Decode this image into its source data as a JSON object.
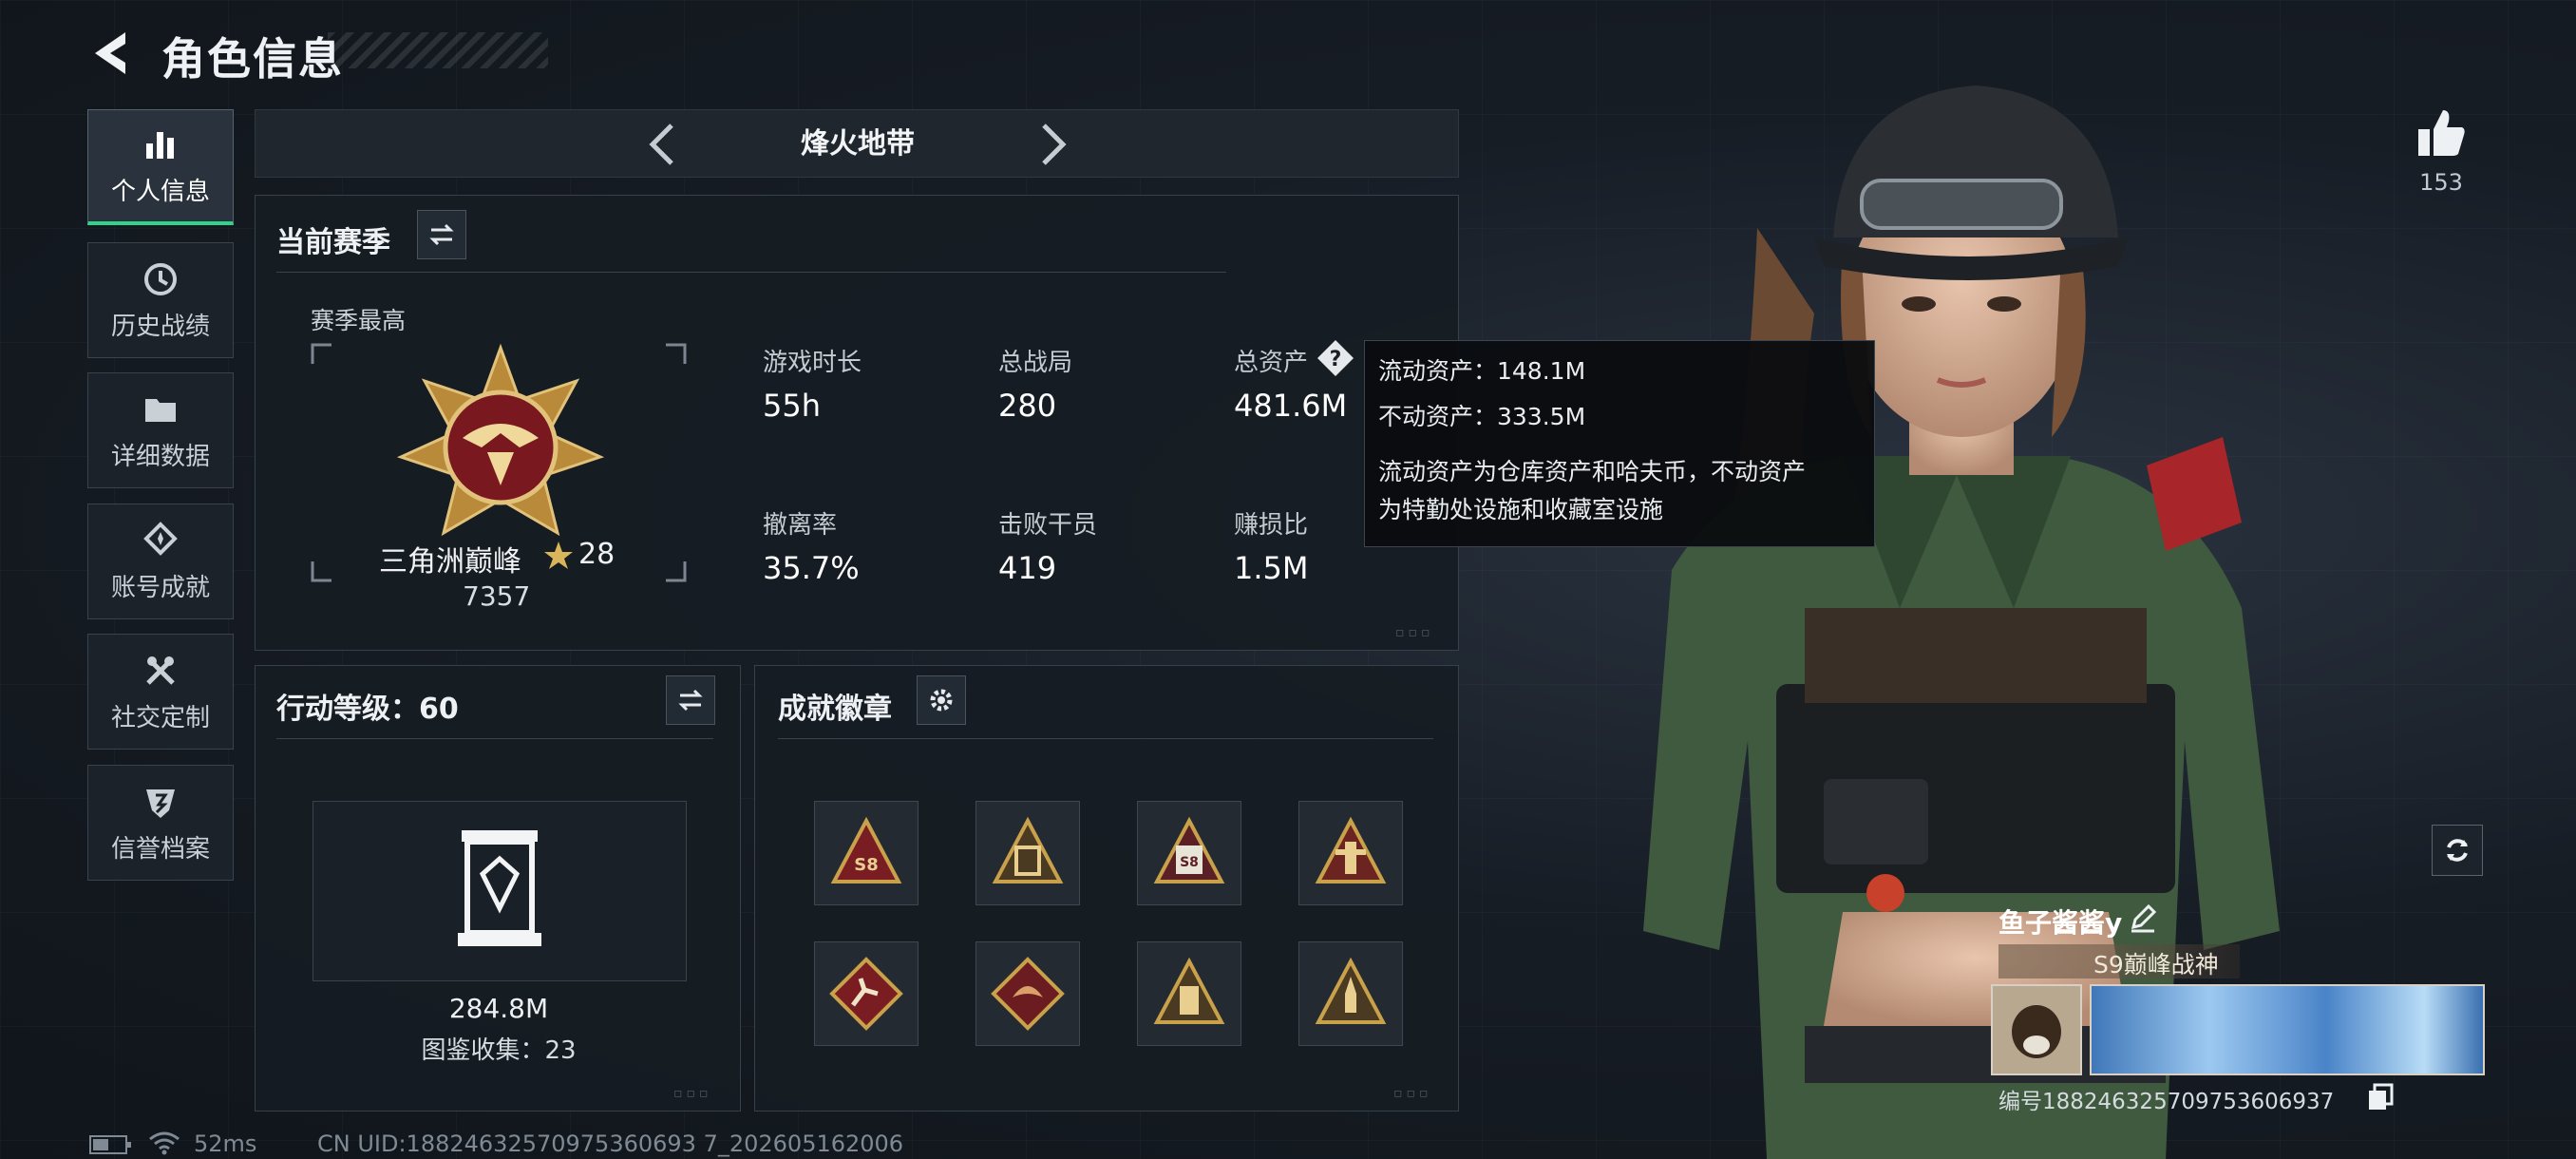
{
  "header": {
    "title": "角色信息"
  },
  "sidebar": {
    "items": [
      {
        "label": "个人信息",
        "icon": "bar-chart-icon",
        "active": true
      },
      {
        "label": "历史战绩",
        "icon": "history-icon"
      },
      {
        "label": "详细数据",
        "icon": "folder-icon"
      },
      {
        "label": "账号成就",
        "icon": "achievement-icon"
      },
      {
        "label": "社交定制",
        "icon": "tools-icon"
      },
      {
        "label": "信誉档案",
        "icon": "credit-shield-icon"
      }
    ]
  },
  "mode": {
    "title": "烽火地带"
  },
  "season": {
    "title": "当前赛季",
    "best_label": "赛季最高",
    "rank_name": "三角洲巅峰",
    "rank_stars": "28",
    "rank_score": "7357",
    "stats": [
      {
        "label": "游戏时长",
        "value": "55h"
      },
      {
        "label": "总战局",
        "value": "280"
      },
      {
        "label": "总资产",
        "value": "481.6M"
      },
      {
        "label": "撤离率",
        "value": "35.7%"
      },
      {
        "label": "击败干员",
        "value": "419"
      },
      {
        "label": "赚损比",
        "value": "1.5M"
      }
    ]
  },
  "tooltip": {
    "liquid": "流动资产：148.1M",
    "fixed": "不动资产：333.5M",
    "desc_line1": "流动资产为仓库资产和哈夫币，不动资产",
    "desc_line2": "为特勤处设施和收藏室设施"
  },
  "action_level": {
    "title": "行动等级：60",
    "value": "284.8M",
    "collection": "图鉴收集：23"
  },
  "achievements": {
    "title": "成就徽章",
    "badges": [
      "badge-s8-icon",
      "badge-barrier-icon",
      "badge-s8-box-icon",
      "badge-tower-icon",
      "badge-runner-icon",
      "badge-dragon-icon",
      "badge-robot-icon",
      "badge-rocket-icon"
    ]
  },
  "likes": {
    "count": "153"
  },
  "player": {
    "name": "鱼子酱酱y",
    "title": "S9巅峰战神",
    "id": "编号1882463257097536069​37"
  },
  "status": {
    "ping": "52ms",
    "uid": "CN UID:18824632570975360693 7_202605162006"
  },
  "colors": {
    "accent": "#2fd38a",
    "gold": "#c9a14a",
    "panel": "#161c23"
  }
}
